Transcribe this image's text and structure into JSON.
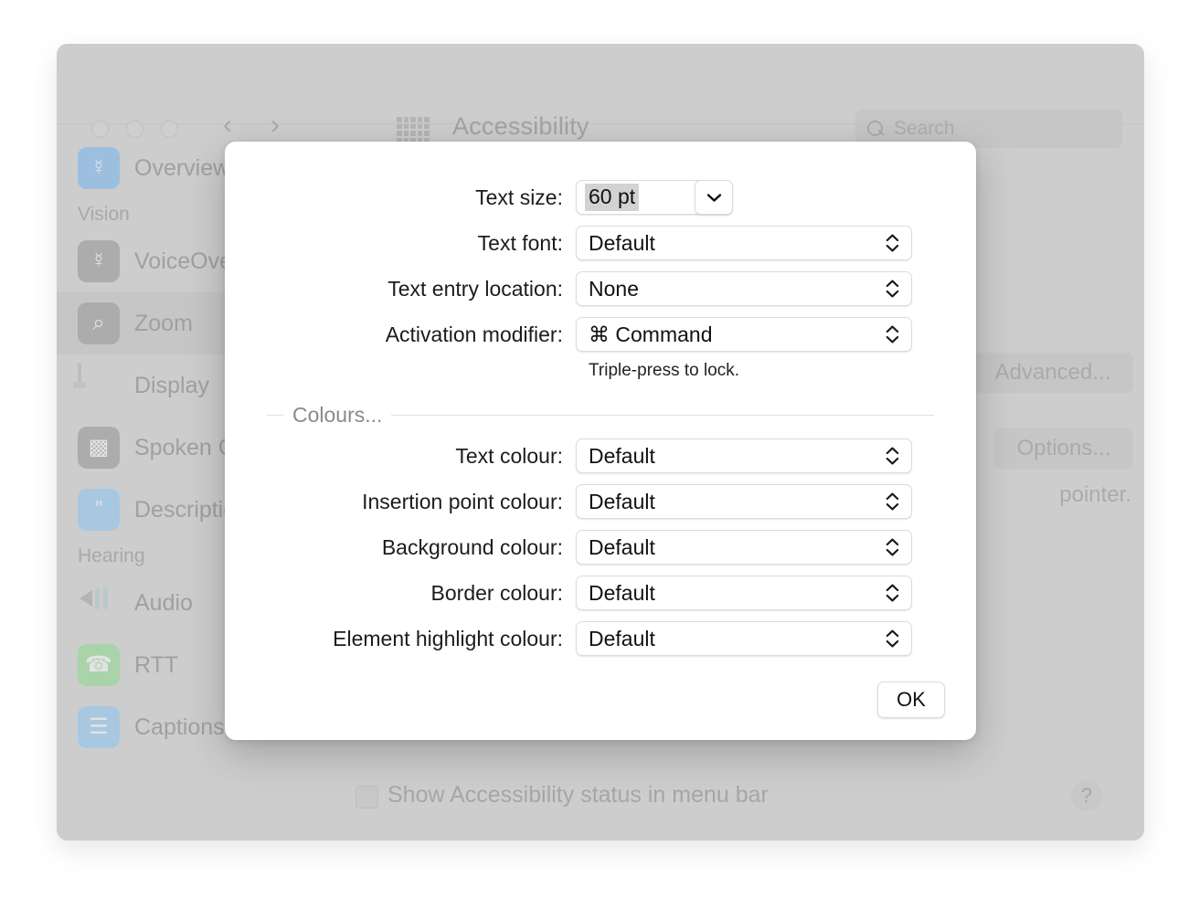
{
  "window": {
    "title": "Accessibility",
    "traffic_lights": [
      "close-button",
      "minimize-button",
      "zoom-button"
    ],
    "nav": {
      "back": "‹",
      "forward": "›"
    },
    "grid_icon": "grid-icon",
    "search": {
      "placeholder": "Search",
      "value": ""
    }
  },
  "sidebar": {
    "items": [
      {
        "label": "Overview",
        "icon": "accessibility-icon",
        "kind": "item",
        "selected": false,
        "color": "blue",
        "glyph": "Ⓙ"
      },
      {
        "label": "Vision",
        "kind": "header"
      },
      {
        "label": "VoiceOver",
        "icon": "voiceover-icon",
        "kind": "item",
        "selected": false,
        "color": "gray",
        "glyph": "Ⓙ"
      },
      {
        "label": "Zoom",
        "icon": "zoom-icon",
        "kind": "item",
        "selected": true,
        "color": "gray",
        "glyph": "⌕"
      },
      {
        "label": "Display",
        "icon": "display-icon",
        "kind": "item",
        "selected": false,
        "color": "none",
        "glyph": ""
      },
      {
        "label": "Spoken Content",
        "icon": "spoken-content-icon",
        "kind": "item",
        "selected": false,
        "color": "gray",
        "glyph": "☷"
      },
      {
        "label": "Descriptions",
        "icon": "descriptions-icon",
        "kind": "item",
        "selected": false,
        "color": "lblue",
        "glyph": "”"
      },
      {
        "label": "Hearing",
        "kind": "header"
      },
      {
        "label": "Audio",
        "icon": "audio-icon",
        "kind": "item",
        "selected": false,
        "color": "none",
        "glyph": ""
      },
      {
        "label": "RTT",
        "icon": "rtt-icon",
        "kind": "item",
        "selected": false,
        "color": "green",
        "glyph": "☎"
      },
      {
        "label": "Captions",
        "icon": "captions-icon",
        "kind": "item",
        "selected": false,
        "color": "lblue",
        "glyph": "☰"
      }
    ]
  },
  "content": {
    "advanced_button": "Advanced...",
    "options_button": "Options...",
    "pointer_text": "pointer.",
    "show_status_checkbox": {
      "label": "Show Accessibility status in menu bar",
      "checked": false
    },
    "help_button": "?"
  },
  "dialog": {
    "rows": [
      {
        "label": "Text size:",
        "value": "60 pt",
        "control": "combo"
      },
      {
        "label": "Text font:",
        "value": "Default",
        "control": "popup"
      },
      {
        "label": "Text entry location:",
        "value": "None",
        "control": "popup"
      },
      {
        "label": "Activation modifier:",
        "value": "⌘ Command",
        "control": "popup"
      }
    ],
    "hint": "Triple-press to lock.",
    "section_title": "Colours...",
    "colour_rows": [
      {
        "label": "Text colour:",
        "value": "Default"
      },
      {
        "label": "Insertion point colour:",
        "value": "Default"
      },
      {
        "label": "Background colour:",
        "value": "Default"
      },
      {
        "label": "Border colour:",
        "value": "Default"
      },
      {
        "label": "Element highlight colour:",
        "value": "Default"
      }
    ],
    "ok_button": "OK"
  },
  "colors": {
    "window_bg": "#cdcdcd",
    "dialog_bg": "#ffffff",
    "selection_highlight": "#d2d2d2",
    "accent_blue": "#9cbfdf",
    "accent_green": "#a9d3a9"
  }
}
